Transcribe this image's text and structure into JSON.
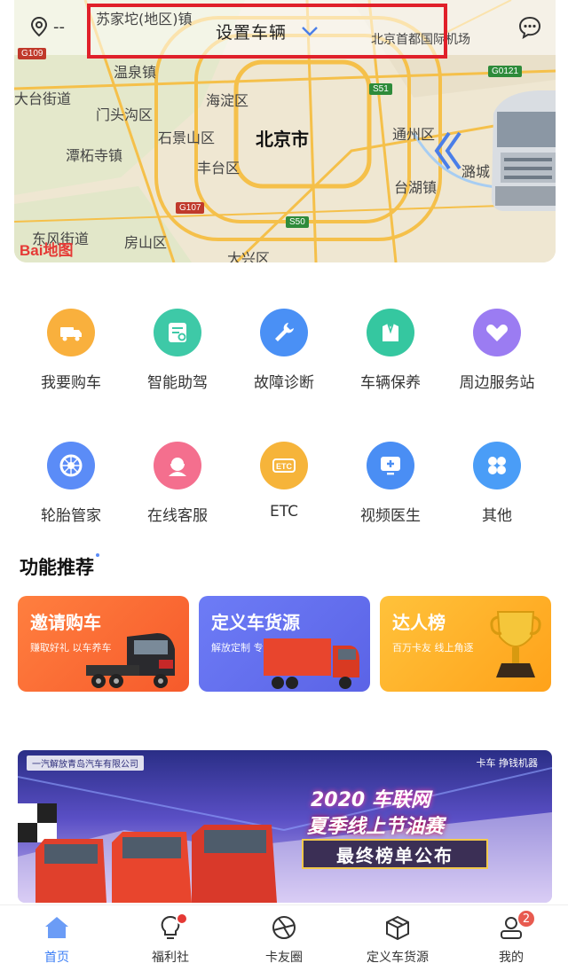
{
  "header": {
    "location_text": "--",
    "vehicle_selector_label": "设置车辆",
    "icons": {
      "location": "location-pin-icon",
      "selector": "chevron-down-icon",
      "message": "chat-bubble-icon"
    }
  },
  "map": {
    "city_label": "北京市",
    "labels": [
      "苏家坨(地区)镇",
      "北京首都国际机场",
      "温泉镇",
      "大台街道",
      "海淀区",
      "门头沟区",
      "石景山区",
      "通州区",
      "潭柘寺镇",
      "丰台区",
      "台湖镇",
      "潞城",
      "东风街道",
      "房山区",
      "大兴区"
    ],
    "road_signs": [
      "G109",
      "S51",
      "G0121",
      "G107",
      "S50"
    ],
    "logo_text": "Bai地图"
  },
  "services": [
    {
      "label": "我要购车",
      "color": "#f9b03d",
      "icon": "truck-icon"
    },
    {
      "label": "智能助驾",
      "color": "#3ec9a7",
      "icon": "smart-drive-icon"
    },
    {
      "label": "故障诊断",
      "color": "#4a90f5",
      "icon": "wrench-icon"
    },
    {
      "label": "车辆保养",
      "color": "#35c7a0",
      "icon": "maintenance-icon"
    },
    {
      "label": "周边服务站",
      "color": "#9b7cf2",
      "icon": "handshake-icon"
    },
    {
      "label": "轮胎管家",
      "color": "#5b8cf7",
      "icon": "tire-icon"
    },
    {
      "label": "在线客服",
      "color": "#f46f8e",
      "icon": "customer-service-icon"
    },
    {
      "label": "ETC",
      "color": "#f6b43a",
      "icon": "etc-icon"
    },
    {
      "label": "视频医生",
      "color": "#4a8ef4",
      "icon": "video-doctor-icon"
    },
    {
      "label": "其他",
      "color": "#4a9df7",
      "icon": "other-icon"
    }
  ],
  "recommend": {
    "title": "功能推荐",
    "cards": [
      {
        "title": "邀请购车",
        "subtitle": "赚取好礼  以车养车"
      },
      {
        "title": "定义车货源",
        "subtitle": "解放定制  专属货源"
      },
      {
        "title": "达人榜",
        "subtitle": "百万卡友  线上角逐"
      }
    ]
  },
  "banner": {
    "company": "一汽解放青岛汽车有限公司",
    "tagline": "卡车  挣钱机器",
    "headline1": "2020 车联网",
    "headline2": "夏季线上节油赛",
    "headline3": "最终榜单公布"
  },
  "tabbar": [
    {
      "label": "首页",
      "active": true,
      "icon": "home-icon"
    },
    {
      "label": "福利社",
      "active": false,
      "icon": "lightbulb-icon",
      "dot": true
    },
    {
      "label": "卡友圈",
      "active": false,
      "icon": "aperture-icon"
    },
    {
      "label": "定义车货源",
      "active": false,
      "icon": "box-icon"
    },
    {
      "label": "我的",
      "active": false,
      "icon": "user-icon",
      "badge": "2"
    }
  ]
}
